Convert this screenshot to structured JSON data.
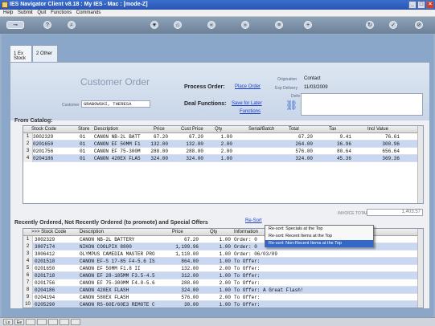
{
  "window": {
    "title": "IES Navigator Client v8.18 : My IES - Mac :     [mode-Z]"
  },
  "menu": [
    "Help",
    "Submit",
    "Quit",
    "Functions",
    "Commands"
  ],
  "tabs": [
    {
      "label": "1 Ex Stock"
    },
    {
      "label": "2 Other"
    }
  ],
  "header": {
    "title": "Customer Order",
    "process_label": "Process Order:",
    "process_link": "Place Order",
    "deal_label": "Deal Functions:",
    "deal_link1": "Save for Later",
    "deal_link2": "Functions",
    "customer_label": "Customer",
    "customer_value": "GRABOWSKI, THERESA",
    "origination_label": "Origination",
    "origination_value": "Contact",
    "exp_delivery_label": "Exp Delivery",
    "exp_delivery_value": "11/03/2009",
    "deliv_instr_label": "Deliv Instr"
  },
  "catalog": {
    "title": "From Catalog:",
    "columns": [
      "Stock Code",
      "Store",
      "Description",
      "Price",
      "Cust Price",
      "Qty",
      "Serial/Batch",
      "Total",
      "Tax",
      "Incl Value"
    ],
    "rows": [
      [
        "1",
        "3002329",
        "01",
        "CANON NB-2L BATT",
        "67.20",
        "67.20",
        "1.00",
        "",
        "67.20",
        "9.41",
        "76.61"
      ],
      [
        "2",
        "0201650",
        "01",
        "CANON EF 50MM F1",
        "132.00",
        "132.00",
        "2.00",
        "",
        "264.00",
        "36.96",
        "300.96"
      ],
      [
        "3",
        "0201756",
        "01",
        "CANON EF 75-300M",
        "288.00",
        "288.00",
        "2.00",
        "",
        "576.00",
        "80.64",
        "656.64"
      ],
      [
        "4",
        "0204186",
        "01",
        "CANON 420EX FLAS",
        "324.00",
        "324.00",
        "1.00",
        "",
        "324.00",
        "45.36",
        "369.36"
      ]
    ],
    "invoice_total_label": "INVOICE TOTAL",
    "invoice_total_value": "1,403.57"
  },
  "recent": {
    "title": "Recently Ordered, Not Recently Ordered (to promote) and Special Offers",
    "resort_link": "Re-Sort",
    "columns": [
      ">>> Stock Code",
      "Description",
      "Price",
      "Qty",
      "Information"
    ],
    "rows": [
      [
        "1",
        "3002329",
        "CANON NB-2L BATTERY",
        "67.20",
        "1.00",
        "Order: 0"
      ],
      [
        "2",
        "3007174",
        "NIKON COOLPIX 8800",
        "1,199.96",
        "1.00",
        "Order: 0"
      ],
      [
        "3",
        "3006412",
        "OLYMPUS CAMEDIA MASTER PRO",
        "1,110.00",
        "1.00",
        "Order: 06/03/09"
      ],
      [
        "4",
        "0201510",
        "CANON EF-S 17-85 F4-5.6 IS",
        "864.00",
        "1.00",
        "To Offer:"
      ],
      [
        "5",
        "0201650",
        "CANON EF 50MM F1.8 II",
        "132.00",
        "2.00",
        "To Offer:"
      ],
      [
        "6",
        "0201718",
        "CANON EF 28-105MM F3.5-4.5",
        "312.00",
        "1.00",
        "To Offer:"
      ],
      [
        "7",
        "0201756",
        "CANON EF 75-300MM F4.0-5.6",
        "288.00",
        "2.00",
        "To Offer:"
      ],
      [
        "8",
        "0204186",
        "CANON 420EX FLASH",
        "324.00",
        "1.00",
        "To Offer: A Great Flash!"
      ],
      [
        "9",
        "0204194",
        "CANON 580EX FLASH",
        "576.00",
        "2.00",
        "To Offer:"
      ],
      [
        "10",
        "0205290",
        "CANON RS-60E/60E3 REMOTE C",
        "30.00",
        "1.00",
        "To Offer:"
      ]
    ]
  },
  "context_menu": {
    "items": [
      "Re-sort: Specials at the Top",
      "Re-sort: Recent Items at the Top",
      "Re-sort: Non-Recent Items at the Top"
    ],
    "selected_index": 2
  },
  "colors": {
    "title_bar": "#2a55b0",
    "link": "#1a3ec8",
    "row_alt": "#c8d8f0",
    "menu_selected": "#3468c8"
  }
}
